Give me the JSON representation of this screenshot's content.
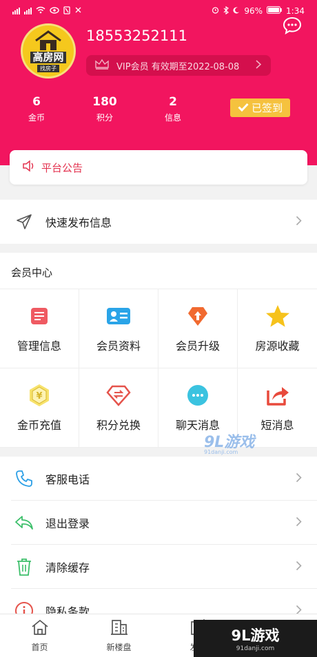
{
  "status_bar": {
    "battery": "96%",
    "time": "1:34"
  },
  "profile": {
    "avatar_brand": "高房网",
    "avatar_tag": "找房子",
    "phone": "18553252111",
    "vip_text": "VIP会员 有效期至2022-08-08"
  },
  "stats": [
    {
      "value": "6",
      "label": "金币"
    },
    {
      "value": "180",
      "label": "积分"
    },
    {
      "value": "2",
      "label": "信息"
    }
  ],
  "signed_label": "已签到",
  "announcement_label": "平台公告",
  "quick_publish_label": "快速发布信息",
  "member_center": {
    "title": "会员中心",
    "items": [
      {
        "label": "管理信息",
        "icon": "manage-info-icon"
      },
      {
        "label": "会员资料",
        "icon": "member-profile-icon"
      },
      {
        "label": "会员升级",
        "icon": "member-upgrade-icon"
      },
      {
        "label": "房源收藏",
        "icon": "star-icon"
      },
      {
        "label": "金币充值",
        "icon": "coin-icon"
      },
      {
        "label": "积分兑换",
        "icon": "exchange-icon"
      },
      {
        "label": "聊天消息",
        "icon": "chat-bubble-icon"
      },
      {
        "label": "短消息",
        "icon": "share-icon"
      }
    ]
  },
  "menu": [
    {
      "label": "客服电话",
      "icon": "phone-icon"
    },
    {
      "label": "退出登录",
      "icon": "logout-icon"
    },
    {
      "label": "清除缓存",
      "icon": "trash-icon"
    },
    {
      "label": "隐私条款",
      "icon": "info-icon"
    }
  ],
  "tabs": [
    {
      "label": "首页",
      "icon": "home-icon"
    },
    {
      "label": "新楼盘",
      "icon": "building-icon"
    },
    {
      "label": "发布",
      "icon": "edit-icon"
    }
  ],
  "watermark": {
    "brand": "9L游戏",
    "site": "91danji.com"
  },
  "colors": {
    "header": "#f2155f",
    "signed": "#f5c23e",
    "accent_text": "#e3324f"
  }
}
